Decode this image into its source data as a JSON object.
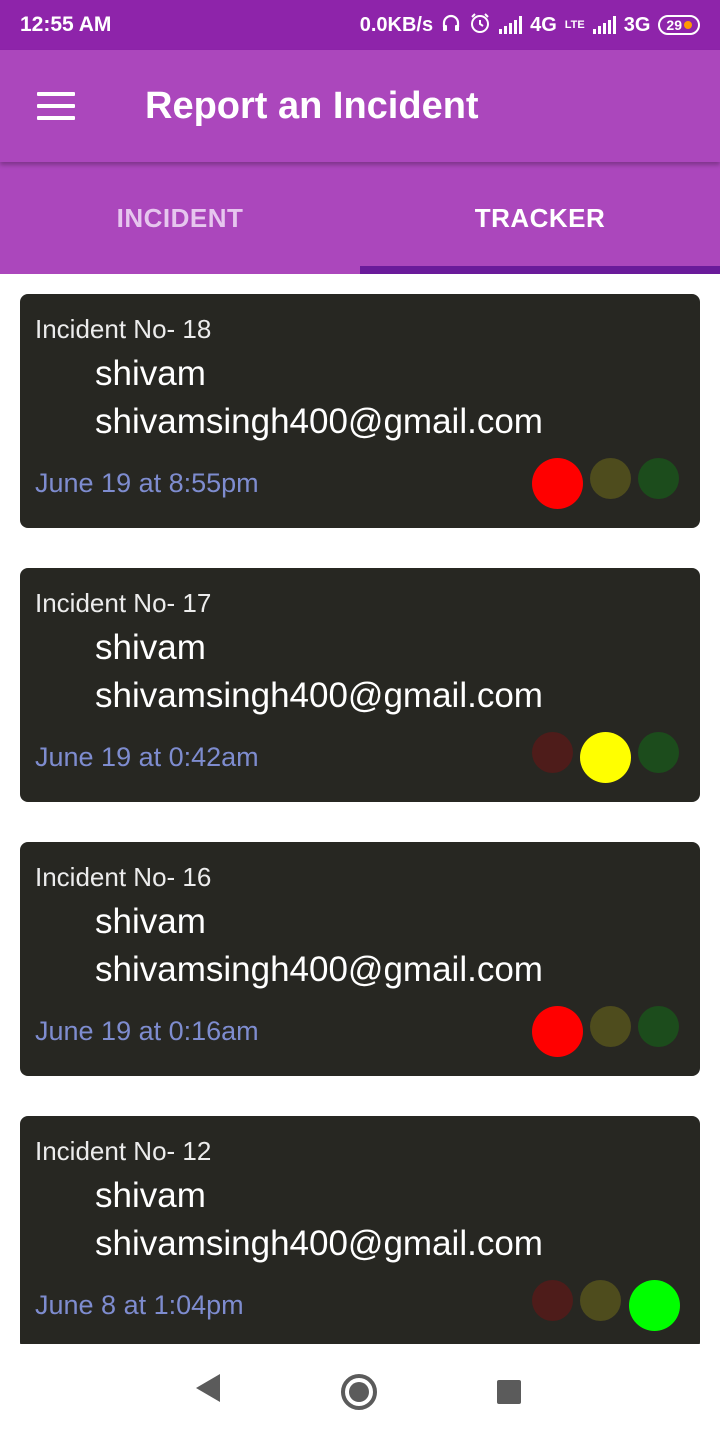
{
  "status_bar": {
    "time": "12:55 AM",
    "net_speed": "0.0KB/s",
    "network_1": "4G",
    "network_1_sub": "LTE",
    "network_2": "3G",
    "battery": "29"
  },
  "app_bar": {
    "menu_icon": "hamburger-icon",
    "title": "Report an Incident"
  },
  "tabs": [
    {
      "label": "INCIDENT",
      "active": false
    },
    {
      "label": "TRACKER",
      "active": true
    }
  ],
  "incidents": [
    {
      "number": "Incident No- 18",
      "name": "shivam",
      "email": "shivamsingh400@gmail.com",
      "date": "June 19 at 8:55pm",
      "status": "red",
      "lights": {
        "red": "#ff0000",
        "yellow": "#4e4c1d",
        "green": "#1c4c1c"
      }
    },
    {
      "number": "Incident No- 17",
      "name": "shivam",
      "email": "shivamsingh400@gmail.com",
      "date": "June 19 at 0:42am",
      "status": "yellow",
      "lights": {
        "red": "#4e1c1a",
        "yellow": "#ffff00",
        "green": "#1c4c1c"
      }
    },
    {
      "number": "Incident No- 16",
      "name": "shivam",
      "email": "shivamsingh400@gmail.com",
      "date": "June 19 at 0:16am",
      "status": "red",
      "lights": {
        "red": "#ff0000",
        "yellow": "#4e4c1d",
        "green": "#1c4c1c"
      }
    },
    {
      "number": "Incident No- 12",
      "name": "shivam",
      "email": "shivamsingh400@gmail.com",
      "date": "June 8 at 1:04pm",
      "status": "green",
      "lights": {
        "red": "#4e1c1a",
        "yellow": "#4e4c1d",
        "green": "#00ff00"
      }
    }
  ],
  "colors": {
    "status_bar": "#8e24aa",
    "app_bar": "#ab47bc",
    "tab_indicator": "#6a1b9a",
    "card_bg": "#272722",
    "date_text": "#7e8ccf"
  },
  "nav_bar": {
    "back_icon": "back-triangle-icon",
    "home_icon": "home-circle-icon",
    "recents_icon": "recents-square-icon"
  }
}
